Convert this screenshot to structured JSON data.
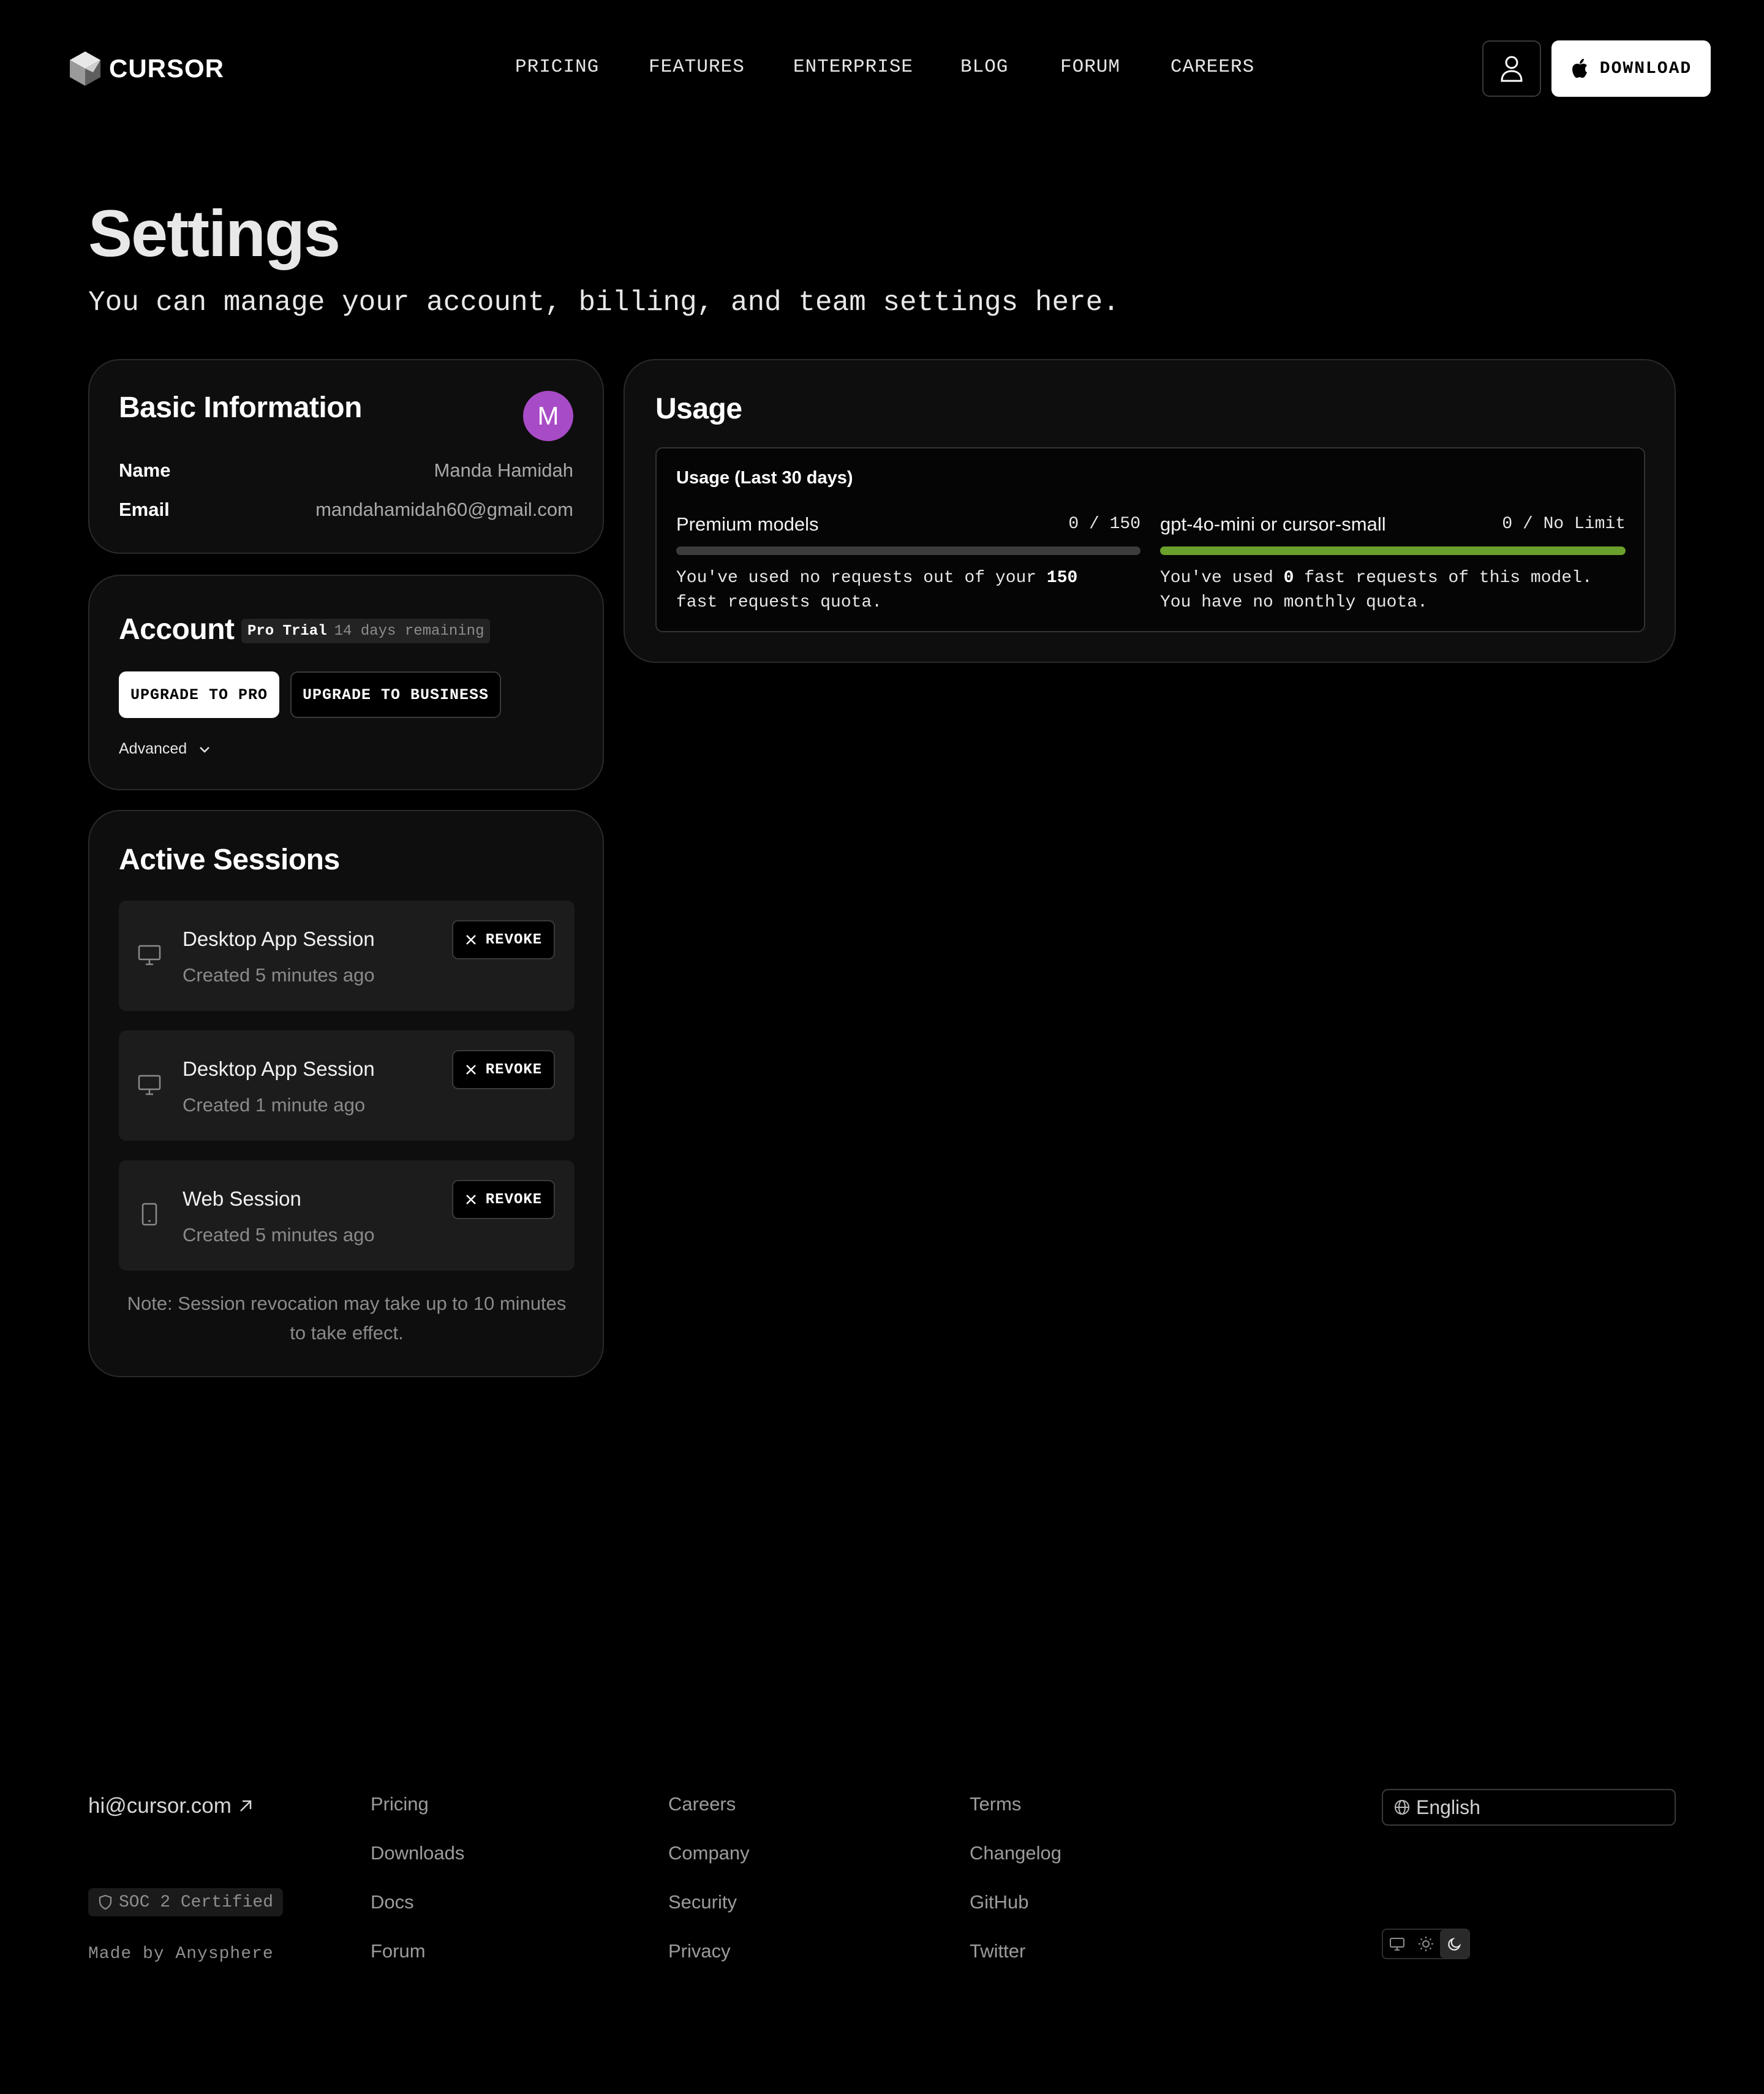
{
  "header": {
    "logo_text": "CURSOR",
    "nav": [
      "PRICING",
      "FEATURES",
      "ENTERPRISE",
      "BLOG",
      "FORUM",
      "CAREERS"
    ],
    "download_label": "DOWNLOAD"
  },
  "page": {
    "title": "Settings",
    "subtitle": "You can manage your account, billing, and team settings here."
  },
  "basic_info": {
    "title": "Basic Information",
    "avatar_letter": "M",
    "avatar_color": "#a84bc6",
    "name_label": "Name",
    "name_value": "Manda Hamidah",
    "email_label": "Email",
    "email_value": "mandahamidah60@gmail.com"
  },
  "account": {
    "title": "Account",
    "plan_badge": "Pro Trial",
    "plan_remaining": "14 days remaining",
    "upgrade_pro_label": "UPGRADE TO PRO",
    "upgrade_business_label": "UPGRADE TO BUSINESS",
    "advanced_label": "Advanced"
  },
  "sessions": {
    "title": "Active Sessions",
    "revoke_label": "REVOKE",
    "items": [
      {
        "name": "Desktop App Session",
        "created": "Created 5 minutes ago",
        "icon": "monitor-icon"
      },
      {
        "name": "Desktop App Session",
        "created": "Created 1 minute ago",
        "icon": "monitor-icon"
      },
      {
        "name": "Web Session",
        "created": "Created 5 minutes ago",
        "icon": "tablet-icon"
      }
    ],
    "note": "Note: Session revocation may take up to 10 minutes to take effect."
  },
  "usage": {
    "title": "Usage",
    "subtitle": "Usage (Last 30 days)",
    "premium": {
      "name": "Premium models",
      "count": "0 / 150",
      "used": 0,
      "quota": 150,
      "desc_prefix": "You've used no requests out of your ",
      "desc_bold": "150",
      "desc_suffix": "fast requests quota."
    },
    "small": {
      "name": "gpt-4o-mini or cursor-small",
      "count": "0 / No Limit",
      "fill_fraction": 1,
      "bar_color": "#6aa02b",
      "desc_prefix": "You've used ",
      "desc_bold": "0",
      "desc_mid": " fast requests of this model.",
      "desc_suffix": "You have no monthly quota."
    }
  },
  "footer": {
    "email": "hi@cursor.com",
    "soc": "SOC 2 Certified",
    "made_by": "Made by Anysphere",
    "col1": [
      "Pricing",
      "Downloads",
      "Docs",
      "Forum"
    ],
    "col2": [
      "Careers",
      "Company",
      "Security",
      "Privacy"
    ],
    "col3": [
      "Terms",
      "Changelog",
      "GitHub",
      "Twitter"
    ],
    "language": "English"
  }
}
